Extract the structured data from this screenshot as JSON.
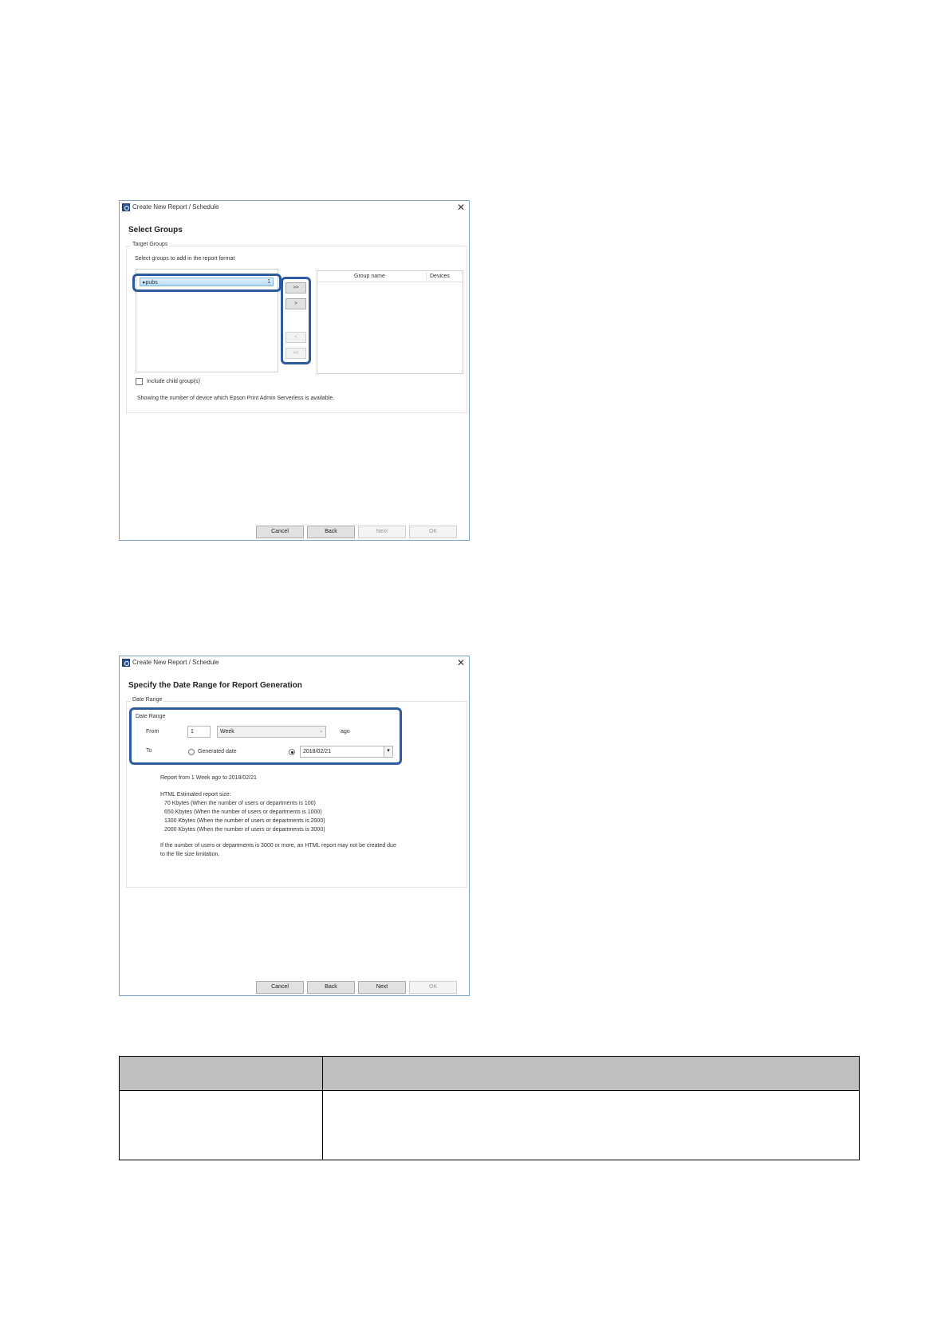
{
  "window1": {
    "title": "Create New Report / Schedule",
    "heading": "Select Groups",
    "groupbox_label": "Target Groups",
    "instruction": "Select groups to add in the report format",
    "tree_item": "▸pubs",
    "tree_item_count": "1",
    "move_buttons": [
      ">>",
      ">",
      "<",
      "<<"
    ],
    "table_headers": [
      "Group name",
      "Devices"
    ],
    "include_child_label": "Include child group(s)",
    "note": "Showing the number of device which Epson Print Admin Serverless is available.",
    "buttons": {
      "cancel": "Cancel",
      "back": "Back",
      "next": "Next",
      "ok": "OK"
    }
  },
  "window2": {
    "title": "Create New Report / Schedule",
    "heading": "Specify the Date Range for Report Generation",
    "groupbox_label": "Date Range",
    "inner_label": "Date Range",
    "from_label": "From",
    "from_value": "1",
    "unit_value": "Week",
    "ago_label": "ago",
    "to_label": "To",
    "generated_date_label": "Generated date",
    "date_value": "2018/02/21",
    "summary": "Report from 1 Week ago to 2018/02/21",
    "size_heading": "HTML Estimated report size:",
    "size_lines": [
      "70 Kbytes (When the number of users or departments is 100)",
      "650 Kbytes (When the number of users or departments is 1000)",
      "1300 Kbytes (When the number of users or departments is 2000)",
      "2000 Kbytes (When the number of users or departments is 3000)"
    ],
    "warning_line1": "If the number of users or departments is 3000 or more, an HTML report may not be created due",
    "warning_line2": "to the file size limitation.",
    "buttons": {
      "cancel": "Cancel",
      "back": "Back",
      "next": "Next",
      "ok": "OK"
    }
  },
  "colors": {
    "highlight": "#2c5aa0",
    "selection": "#cce8ff",
    "header_gray": "#bfbfbf"
  }
}
